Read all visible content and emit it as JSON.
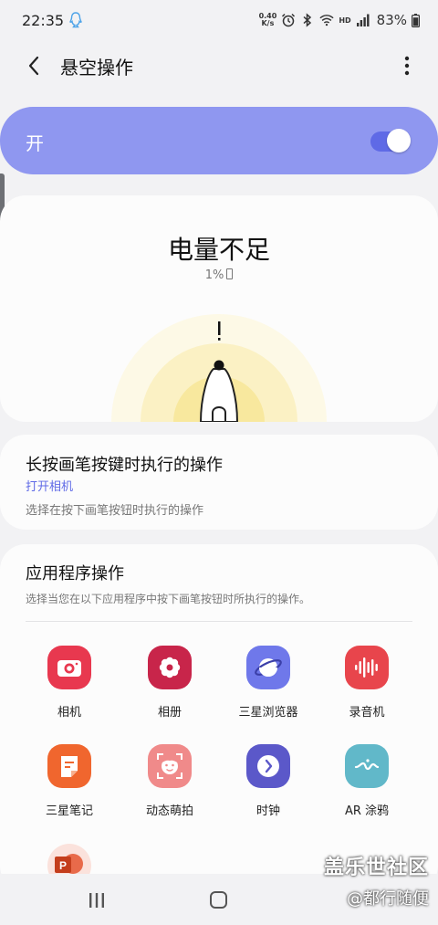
{
  "status_bar": {
    "time": "22:35",
    "netspeed_value": "0.40",
    "netspeed_unit": "K/s",
    "hd": "HD",
    "battery_percent": "83%"
  },
  "app_bar": {
    "title": "悬空操作"
  },
  "master_toggle": {
    "label": "开",
    "state": "on",
    "accent_color": "#8f97f0"
  },
  "battery_card": {
    "title": "电量不足",
    "level": "1%"
  },
  "long_press": {
    "title": "长按画笔按键时执行的操作",
    "action": "打开相机",
    "description": "选择在按下画笔按钮时执行的操作"
  },
  "apps": {
    "title": "应用程序操作",
    "description": "选择当您在以下应用程序中按下画笔按钮时所执行的操作。",
    "items": [
      {
        "label": "相机",
        "icon": "camera-icon",
        "color": "#e8384f"
      },
      {
        "label": "相册",
        "icon": "gallery-flower-icon",
        "color": "#c8254a"
      },
      {
        "label": "三星浏览器",
        "icon": "internet-planet-icon",
        "color": "#6f78ea"
      },
      {
        "label": "录音机",
        "icon": "voice-recorder-icon",
        "color": "#e8454c"
      },
      {
        "label": "三星笔记",
        "icon": "notes-icon",
        "color": "#f0662e"
      },
      {
        "label": "动态萌拍",
        "icon": "ar-emoji-face-icon",
        "color": "#f08a8a"
      },
      {
        "label": "时钟",
        "icon": "clock-icon",
        "color": "#5b58c9"
      },
      {
        "label": "AR 涂鸦",
        "icon": "ar-doodle-icon",
        "color": "#61b8c9"
      }
    ],
    "partial_item_icon": "powerpoint-icon"
  },
  "watermark": {
    "line1": "盖乐世社区",
    "line2": "@都行随便"
  }
}
